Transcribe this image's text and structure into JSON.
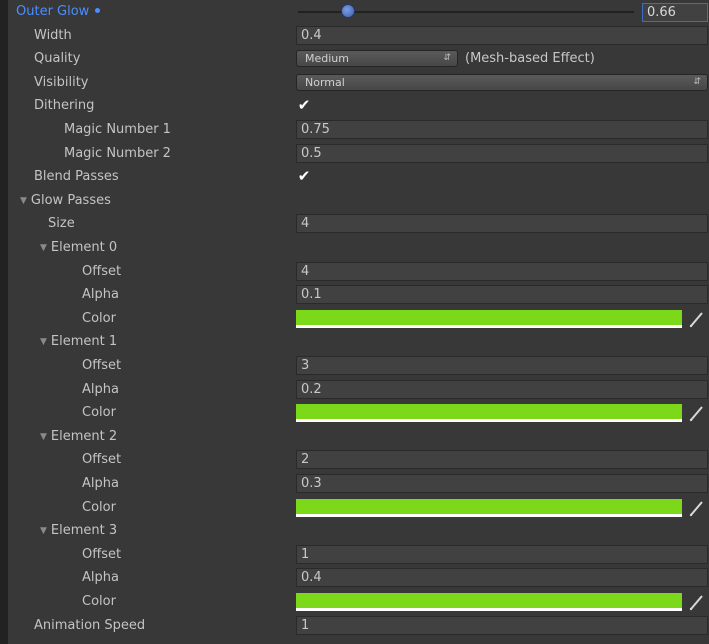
{
  "outer_glow": {
    "label": "Outer Glow",
    "value": "0.66",
    "slider_fraction": 0.15
  },
  "width": {
    "label": "Width",
    "value": "0.4"
  },
  "quality": {
    "label": "Quality",
    "value": "Medium",
    "note": "(Mesh-based Effect)"
  },
  "visibility": {
    "label": "Visibility",
    "value": "Normal"
  },
  "dithering": {
    "label": "Dithering",
    "checked": true
  },
  "magic1": {
    "label": "Magic Number 1",
    "value": "0.75"
  },
  "magic2": {
    "label": "Magic Number 2",
    "value": "0.5"
  },
  "blend_passes": {
    "label": "Blend Passes",
    "checked": true
  },
  "glow_passes": {
    "label": "Glow Passes",
    "size_label": "Size",
    "size": "4",
    "elements": [
      {
        "label": "Element 0",
        "offset_label": "Offset",
        "offset": "4",
        "alpha_label": "Alpha",
        "alpha": "0.1",
        "color_label": "Color",
        "color": "#7cd91a"
      },
      {
        "label": "Element 1",
        "offset_label": "Offset",
        "offset": "3",
        "alpha_label": "Alpha",
        "alpha": "0.2",
        "color_label": "Color",
        "color": "#7cd91a"
      },
      {
        "label": "Element 2",
        "offset_label": "Offset",
        "offset": "2",
        "alpha_label": "Alpha",
        "alpha": "0.3",
        "color_label": "Color",
        "color": "#7cd91a"
      },
      {
        "label": "Element 3",
        "offset_label": "Offset",
        "offset": "1",
        "alpha_label": "Alpha",
        "alpha": "0.4",
        "color_label": "Color",
        "color": "#7cd91a"
      }
    ]
  },
  "animation_speed": {
    "label": "Animation Speed",
    "value": "1"
  },
  "icons": {
    "foldout": "foldout-arrow-icon",
    "picker": "eyedropper-icon",
    "check": "checkmark-icon"
  },
  "colors": {
    "accent": "#4b8eff",
    "background": "#383838",
    "field": "#414141",
    "glow_color": "#7cd91a"
  }
}
